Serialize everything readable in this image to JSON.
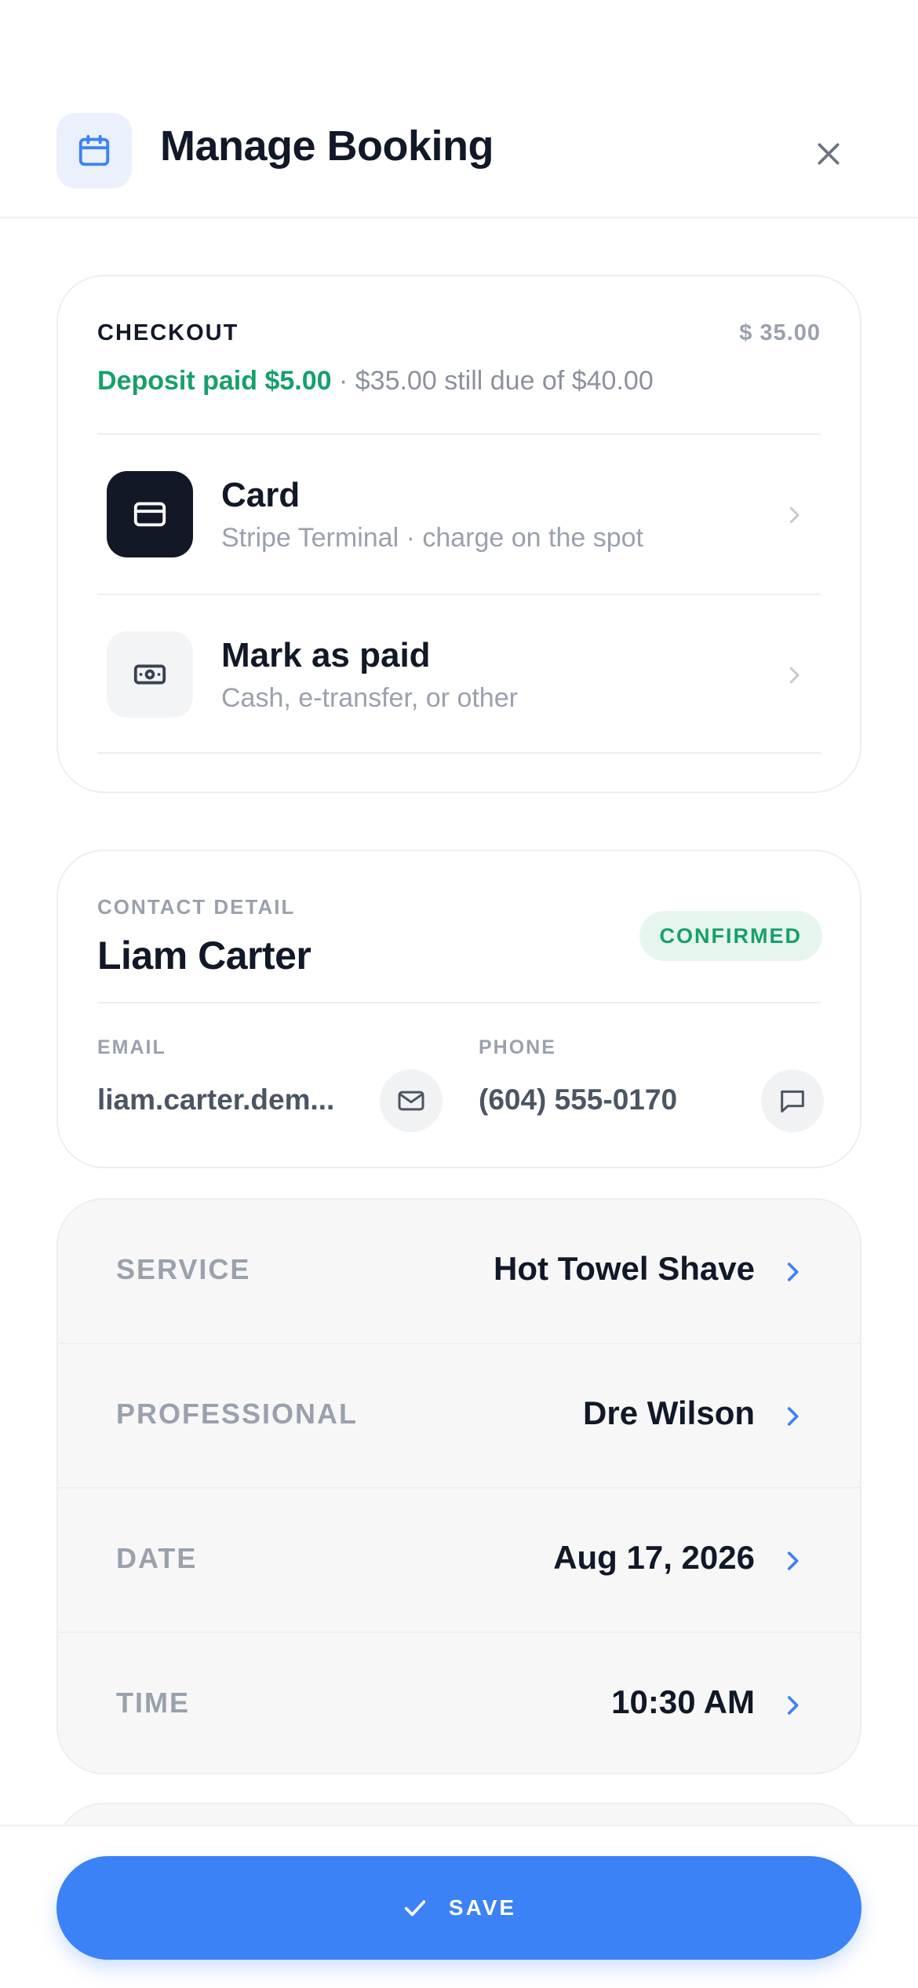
{
  "header": {
    "title": "Manage Booking",
    "icon": "calendar-icon",
    "close_icon": "close-icon",
    "accent": "#3b82f6"
  },
  "checkout": {
    "title": "CHECKOUT",
    "amount": "$ 35.00",
    "deposit_text": "Deposit paid $5.00",
    "due_text": " · $35.00 still due of $40.00",
    "options": [
      {
        "title": "Card",
        "description": "Stripe Terminal · charge on the spot",
        "icon": "credit-card-icon"
      },
      {
        "title": "Mark as paid",
        "description": "Cash, e-transfer, or other",
        "icon": "cash-icon"
      }
    ]
  },
  "contact": {
    "label": "CONTACT DETAIL",
    "name": "Liam Carter",
    "status": "CONFIRMED",
    "email_label": "EMAIL",
    "email_value": "liam.carter.dem...",
    "phone_label": "PHONE",
    "phone_value": "(604) 555-0170",
    "email_icon": "mail-icon",
    "message_icon": "message-icon"
  },
  "details": [
    {
      "label": "SERVICE",
      "value": "Hot Towel Shave"
    },
    {
      "label": "PROFESSIONAL",
      "value": "Dre Wilson"
    },
    {
      "label": "DATE",
      "value": "Aug 17, 2026"
    },
    {
      "label": "TIME",
      "value": "10:30 AM"
    }
  ],
  "footer": {
    "save_label": "SAVE",
    "save_icon": "check-icon"
  }
}
